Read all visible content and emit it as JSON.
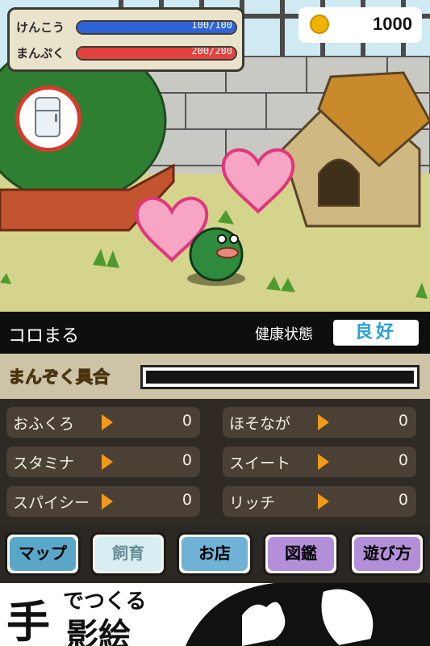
{
  "hud": {
    "health_label": "けんこう",
    "health_value": "100/100",
    "health_fraction": 1.0,
    "fullness_label": "まんぷく",
    "fullness_value": "200/200",
    "fullness_fraction": 1.0,
    "health_color": "#2f64d8",
    "fullness_color": "#e2423e"
  },
  "coins": "1000",
  "pet": {
    "name": "コロまる",
    "health_label": "健康状態",
    "health_status": "良好"
  },
  "satisfaction": {
    "label": "まんぞく具合",
    "fraction": 0
  },
  "stats": [
    {
      "label": "おふくろ",
      "value": "0"
    },
    {
      "label": "ほそなが",
      "value": "0"
    },
    {
      "label": "スタミナ",
      "value": "0"
    },
    {
      "label": "スイート",
      "value": "0"
    },
    {
      "label": "スパイシー",
      "value": "0"
    },
    {
      "label": "リッチ",
      "value": "0"
    }
  ],
  "nav": {
    "map": "マップ",
    "raise": "飼育",
    "shop": "お店",
    "encyclopedia": "図鑑",
    "howto": "遊び方",
    "map_color": "#5aa7c9",
    "raise_color": "#d7eef2",
    "shop_color": "#6fb2d6",
    "encyclopedia_color": "#b48fd9",
    "howto_color": "#b48fd9"
  },
  "banner": {
    "te": "手",
    "de_tsukuru": "でつくる",
    "kage_e": "影絵"
  }
}
